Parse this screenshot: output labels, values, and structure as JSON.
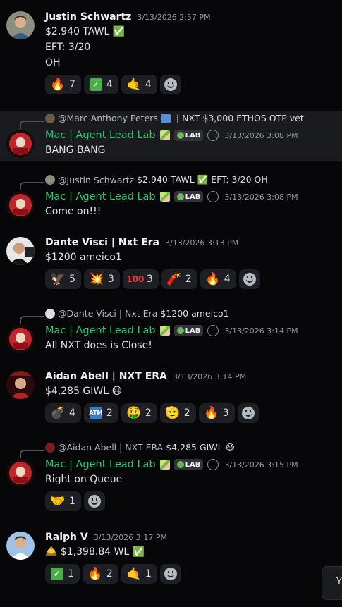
{
  "messages": [
    {
      "author": "Justin Schwartz",
      "timestamp": "3/13/2026 2:57 PM",
      "lines": [
        "$2,940 TAWL ✅",
        "EFT: 3/20",
        "OH"
      ],
      "reactions": [
        {
          "emoji": "fire",
          "count": "7"
        },
        {
          "emoji": "check",
          "count": "4"
        },
        {
          "emoji": "call-me-hand",
          "count": "4"
        }
      ]
    },
    {
      "reply_to": "@Marc Anthony Peters",
      "reply_text": "| NXT $3,000 ETHOS  OTP vet",
      "author": "Mac | Agent Lead Lab",
      "badge": "LAB",
      "timestamp": "3/13/2026 3:08 PM",
      "lines": [
        "BANG BANG"
      ]
    },
    {
      "reply_to": "@Justin Schwartz",
      "reply_text": "$2,940 TAWL ✅ EFT: 3/20 OH",
      "author": "Mac | Agent Lead Lab",
      "badge": "LAB",
      "timestamp": "3/13/2026 3:08 PM",
      "lines": [
        "Come on!!!"
      ]
    },
    {
      "author": "Dante Visci | Nxt Era",
      "timestamp": "3/13/2026 3:13 PM",
      "lines": [
        "$1200 ameico1"
      ],
      "reactions": [
        {
          "emoji": "eagle",
          "count": "5"
        },
        {
          "emoji": "collision",
          "count": "3"
        },
        {
          "emoji": "hundred",
          "count": "3"
        },
        {
          "emoji": "firecracker",
          "count": "2"
        },
        {
          "emoji": "fire",
          "count": "4"
        }
      ]
    },
    {
      "reply_to": "@Dante Visci | Nxt Era",
      "reply_text": "$1200 ameico1",
      "author": "Mac | Agent Lead Lab",
      "badge": "LAB",
      "timestamp": "3/13/2026 3:14 PM",
      "lines": [
        "All NXT does is Close!"
      ]
    },
    {
      "author": "Aidan Abell | NXT ERA",
      "timestamp": "3/13/2026 3:14 PM",
      "lines": [
        "$4,285 GIWL 😷"
      ],
      "reactions": [
        {
          "emoji": "bomb",
          "count": "4"
        },
        {
          "emoji": "atm",
          "count": "2"
        },
        {
          "emoji": "money-mouth",
          "count": "2"
        },
        {
          "emoji": "saluting-face",
          "count": "2"
        },
        {
          "emoji": "fire",
          "count": "3"
        }
      ]
    },
    {
      "reply_to": "@Aidan Abell | NXT ERA",
      "reply_text": "$4,285 GIWL 😷",
      "author": "Mac | Agent Lead Lab",
      "badge": "LAB",
      "timestamp": "3/13/2026 3:15 PM",
      "lines": [
        "Right on Queue"
      ],
      "reactions": [
        {
          "emoji": "handshake",
          "count": "1"
        }
      ]
    },
    {
      "author": "Ralph V",
      "timestamp": "3/13/2026 3:17 PM",
      "lines": [
        "🛎️ $1,398.84 WL ✅"
      ],
      "reactions": [
        {
          "emoji": "check",
          "count": "1"
        },
        {
          "emoji": "fire",
          "count": "2"
        },
        {
          "emoji": "call-me-hand",
          "count": "1"
        }
      ]
    }
  ],
  "popup_text": "Y"
}
